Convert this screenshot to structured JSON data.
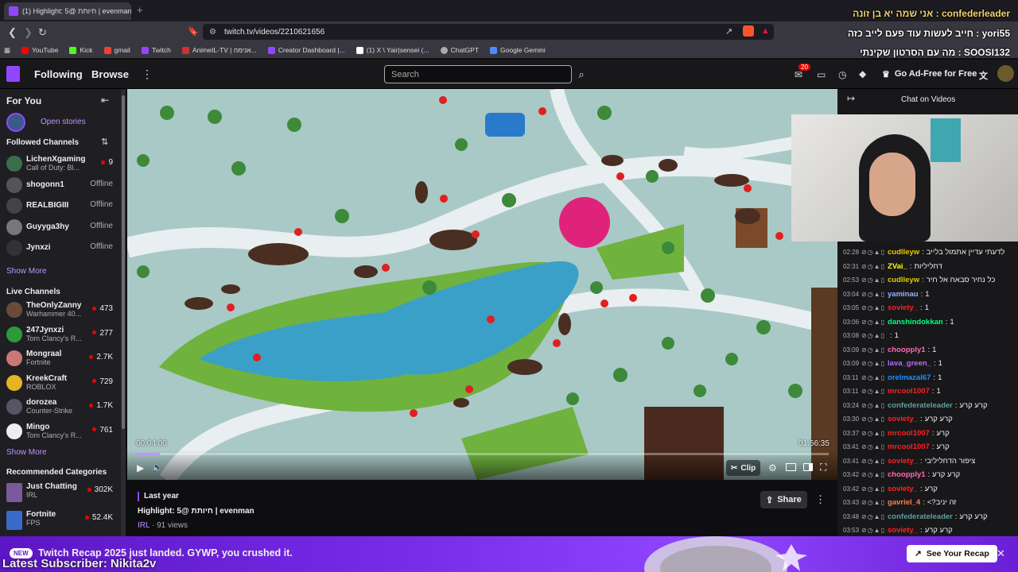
{
  "browser": {
    "tab_title": "(1) Highlight: 5@ חיותת | evenman",
    "url": "twitch.tv/videos/2210621656",
    "bookmarks": [
      "YouTube",
      "Kick",
      "gmail",
      "Twitch",
      "AnimeIL-TV | אנימה...",
      "Creator Dashboard |...",
      "(1) X \\ Yair|sensei (...",
      "ChatGPT",
      "Google Gemini"
    ]
  },
  "overlay": {
    "line1": "אני שמה יא בן זונה : confederleader",
    "line2": "חייב לעשות עוד פעם לייב כזה : yori55",
    "line3": "מה עם הסרטון שקינתי : SOOSI132",
    "subscriber": "Latest Subscriber: Nikita2v"
  },
  "nav": {
    "following": "Following",
    "browse": "Browse",
    "search_placeholder": "Search",
    "notif_count": "20",
    "adfree": "Go Ad-Free for Free"
  },
  "sidebar": {
    "for_you": "For You",
    "open_stories": "Open stories",
    "followed_title": "Followed Channels",
    "followed": [
      {
        "name": "LichenXgaming",
        "game": "Call of Duty: Bl...",
        "viewers": "9",
        "color": "#3b6e4a"
      },
      {
        "name": "shogonn1",
        "game": "",
        "viewers": "Offline",
        "color": "#555"
      },
      {
        "name": "REALBIGIII",
        "game": "",
        "viewers": "Offline",
        "color": "#444"
      },
      {
        "name": "Guyyga3hy",
        "game": "",
        "viewers": "Offline",
        "color": "#777"
      },
      {
        "name": "Jynxzi",
        "game": "",
        "viewers": "Offline",
        "color": "#333"
      }
    ],
    "show_more": "Show More",
    "live_title": "Live Channels",
    "live": [
      {
        "name": "TheOnlyZanny",
        "game": "Warhammer 40...",
        "viewers": "473",
        "color": "#6b4a3a"
      },
      {
        "name": "247Jynxzi",
        "game": "Tom Clancy's R...",
        "viewers": "277",
        "color": "#2b9b3a"
      },
      {
        "name": "Mongraal",
        "game": "Fortnite",
        "viewers": "2.7K",
        "color": "#c77"
      },
      {
        "name": "KreekCraft",
        "game": "ROBLOX",
        "viewers": "729",
        "color": "#e6b422"
      },
      {
        "name": "dorozea",
        "game": "Counter-Strike",
        "viewers": "1.7K",
        "color": "#556"
      },
      {
        "name": "Mingo",
        "game": "Tom Clancy's R...",
        "viewers": "761",
        "color": "#eee"
      }
    ],
    "show_more2": "Show More",
    "rec_title": "Recommended Categories",
    "rec": [
      {
        "name": "Just Chatting",
        "game": "IRL",
        "viewers": "302K",
        "color": "#7a5a9a"
      },
      {
        "name": "Fortnite",
        "game": "FPS",
        "viewers": "52.4K",
        "color": "#3a6ac9"
      }
    ]
  },
  "player": {
    "time_current": "00:04:00",
    "time_total": "01:56:35",
    "clip": "Clip",
    "progress": 0.034
  },
  "info": {
    "date": "Last year",
    "title": "Highlight: 5@ חיותת | evenman",
    "category": "IRL",
    "views": "91 views",
    "share": "Share"
  },
  "chat": {
    "title": "Chat on Videos",
    "messages": [
      {
        "t": "02:28",
        "u": "cudlleyw",
        "c": "#e6c800",
        "m": "לדעתי עדיין אתמול בלייב"
      },
      {
        "t": "02:31",
        "u": "ZVai_",
        "c": "#ffff00",
        "m": "דחליליות"
      },
      {
        "t": "02:53",
        "u": "cudlleyw",
        "c": "#e6c800",
        "m": "כל נחיר סבאח אל חיר"
      },
      {
        "t": "03:04",
        "u": "yaminau",
        "c": "#9ab0ff",
        "m": "1"
      },
      {
        "t": "03:05",
        "u": "soviety_",
        "c": "#ff2020",
        "m": "1"
      },
      {
        "t": "03:06",
        "u": "danshindokkan",
        "c": "#00ff7f",
        "m": "1"
      },
      {
        "t": "03:08",
        "u": "",
        "c": "#3d7bff",
        "m": "1"
      },
      {
        "t": "03:09",
        "u": "choopply1",
        "c": "#ff69b4",
        "m": "1"
      },
      {
        "t": "03:09",
        "u": "lava_green_",
        "c": "#b86bff",
        "m": "1"
      },
      {
        "t": "03:11",
        "u": "orelmazal67",
        "c": "#1e90ff",
        "m": "1"
      },
      {
        "t": "03:11",
        "u": "mrcool1007",
        "c": "#ff2020",
        "m": "1"
      },
      {
        "t": "03:24",
        "u": "confederateleader",
        "c": "#5f9ea0",
        "m": "קרע קרע"
      },
      {
        "t": "03:30",
        "u": "soviety_",
        "c": "#ff2020",
        "m": "קרע קרע"
      },
      {
        "t": "03:37",
        "u": "mrcool1007",
        "c": "#ff2020",
        "m": "קרע"
      },
      {
        "t": "03:41",
        "u": "mrcool1007",
        "c": "#ff2020",
        "m": "קרע"
      },
      {
        "t": "03:41",
        "u": "soviety_",
        "c": "#ff2020",
        "m": "ציפור הדחליליבי"
      },
      {
        "t": "03:42",
        "u": "choopply1",
        "c": "#ff69b4",
        "m": "קרע קרע"
      },
      {
        "t": "03:42",
        "u": "soviety_",
        "c": "#ff2020",
        "m": "קרע"
      },
      {
        "t": "03:43",
        "u": "gavriel_4",
        "c": "#ff7f50",
        "m": "<?זה יניב"
      },
      {
        "t": "03:48",
        "u": "confederateleader",
        "c": "#5f9ea0",
        "m": "קרע קרע"
      },
      {
        "t": "03:53",
        "u": "soviety_",
        "c": "#ff2020",
        "m": "קרע קרע"
      }
    ]
  },
  "banner": {
    "tag": "NEW",
    "text": "Twitch Recap 2025 just landed. GYWP, you crushed it.",
    "button": "See Your Recap"
  }
}
